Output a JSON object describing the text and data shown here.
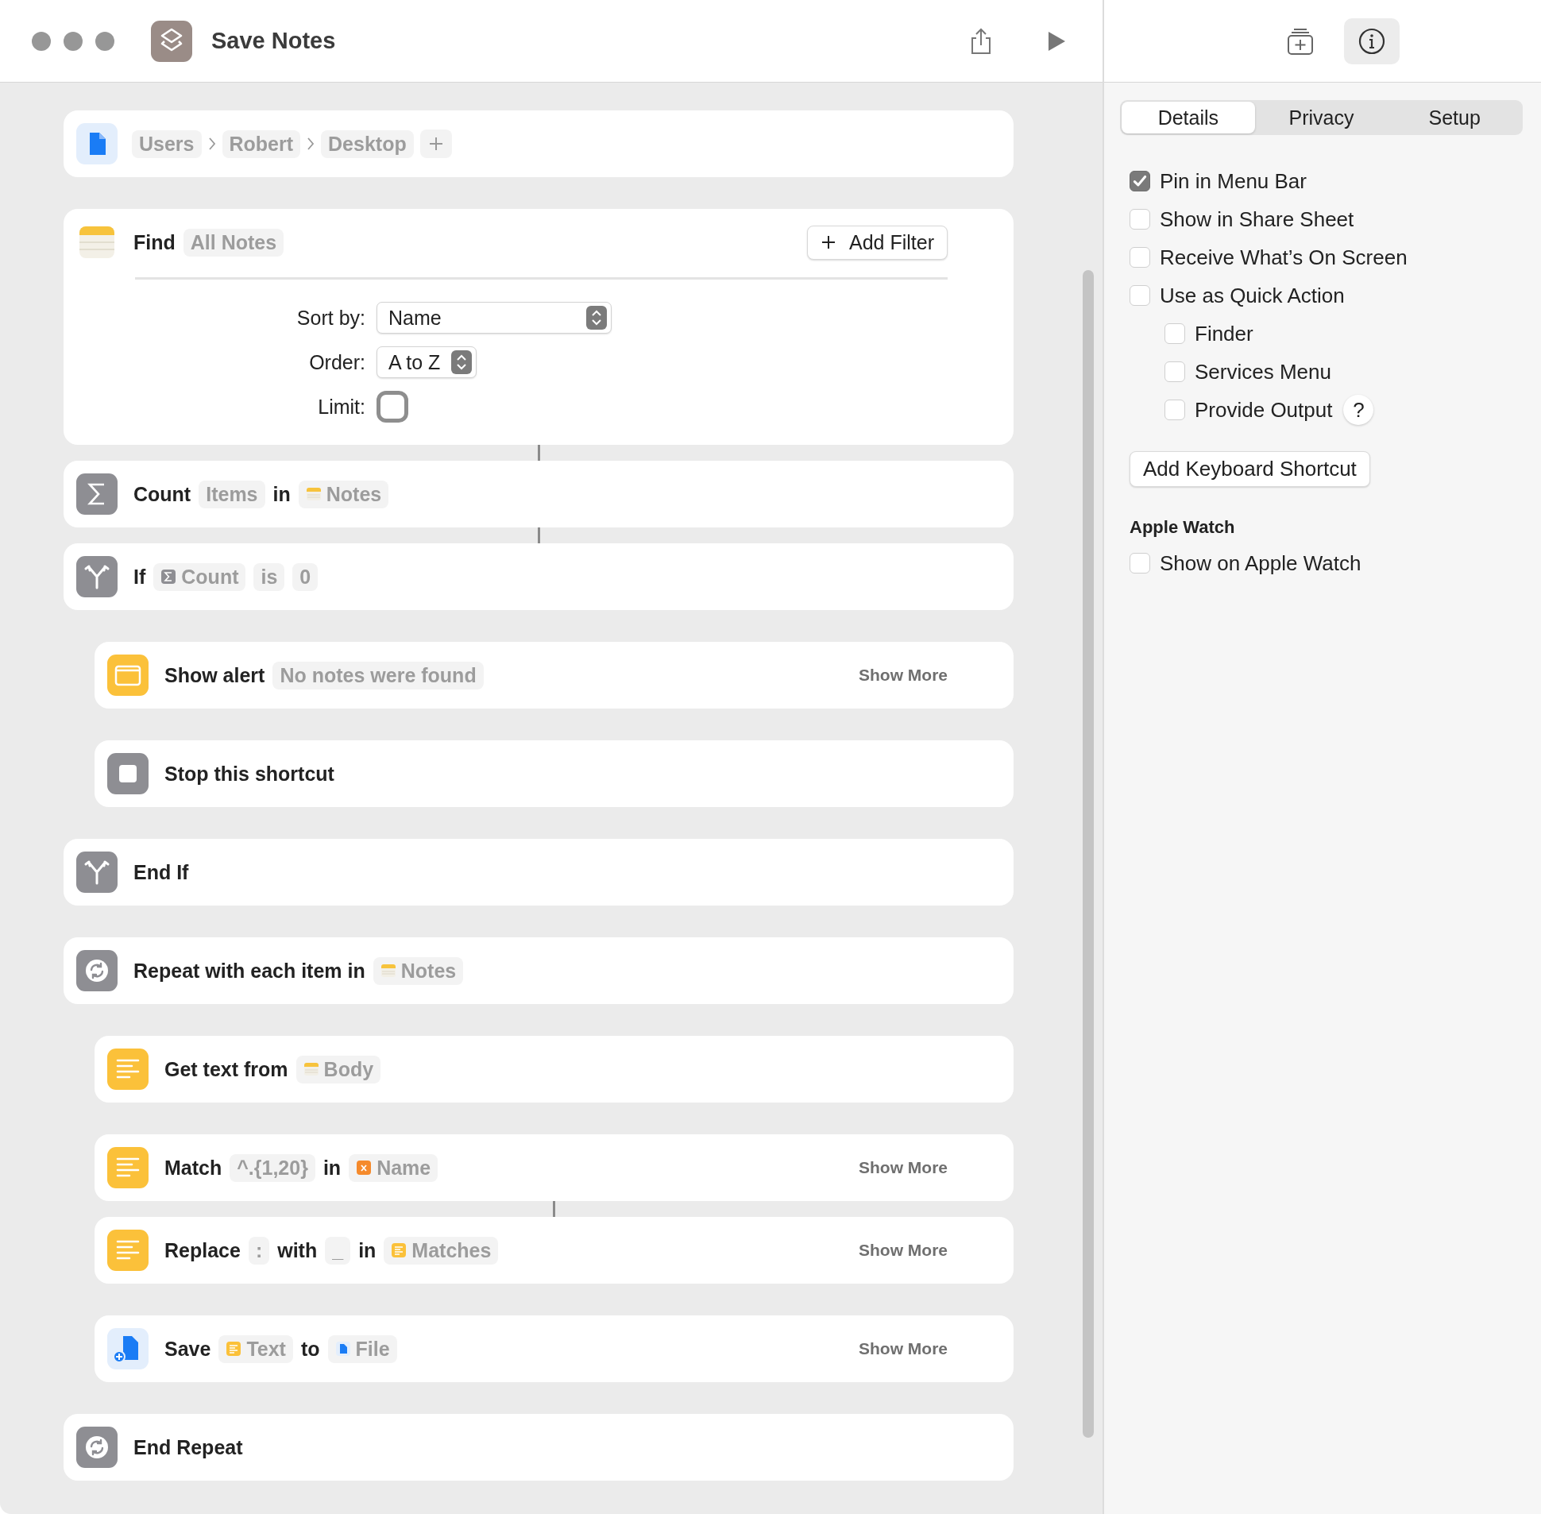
{
  "window": {
    "title": "Save Notes"
  },
  "toolbar_buttons": [
    {
      "kind": "library",
      "selected": false
    },
    {
      "kind": "info",
      "selected": true
    }
  ],
  "actions": [
    {
      "kind": "file-path",
      "parts": [
        {
          "kind": "crumb",
          "text": "Users"
        },
        {
          "kind": "crumb",
          "text": "Robert"
        },
        {
          "kind": "crumb",
          "text": "Desktop"
        }
      ],
      "connected": false
    },
    {
      "kind": "find",
      "parts": [
        {
          "kind": "label",
          "text": "Find"
        },
        {
          "kind": "token",
          "text": "All Notes"
        }
      ],
      "add_filter": "Add Filter",
      "options": [
        {
          "kind": "popup",
          "label": "Sort by:",
          "value": "Name",
          "wide": true
        },
        {
          "kind": "popup",
          "label": "Order:",
          "value": "A to Z",
          "wide": false
        },
        {
          "kind": "toggle",
          "label": "Limit:",
          "on": false
        }
      ],
      "connected": true
    },
    {
      "kind": "count",
      "parts": [
        {
          "kind": "label",
          "text": "Count"
        },
        {
          "kind": "token",
          "text": "Items"
        },
        {
          "kind": "label",
          "text": "in"
        },
        {
          "kind": "notes-token",
          "text": "Notes"
        }
      ],
      "connected": true
    },
    {
      "kind": "if",
      "parts": [
        {
          "kind": "label",
          "text": "If"
        },
        {
          "kind": "count-token",
          "text": "Count"
        },
        {
          "kind": "token",
          "text": "is"
        },
        {
          "kind": "token",
          "text": "0"
        }
      ],
      "connected": false,
      "children": [
        {
          "kind": "alert",
          "parts": [
            {
              "kind": "label",
              "text": "Show alert"
            },
            {
              "kind": "token",
              "text": "No notes were found"
            }
          ],
          "show_more": "Show More",
          "connected": false
        },
        {
          "kind": "stop",
          "parts": [
            {
              "kind": "label",
              "text": "Stop this shortcut"
            }
          ],
          "connected": false
        }
      ]
    },
    {
      "kind": "end-if",
      "parts": [
        {
          "kind": "label",
          "text": "End If"
        }
      ],
      "connected": false
    },
    {
      "kind": "repeat",
      "parts": [
        {
          "kind": "label",
          "text": "Repeat with each item in"
        },
        {
          "kind": "notes-token",
          "text": "Notes"
        }
      ],
      "connected": false,
      "children": [
        {
          "kind": "text",
          "parts": [
            {
              "kind": "label",
              "text": "Get text from"
            },
            {
              "kind": "notes-token",
              "text": "Body"
            }
          ],
          "connected": false
        },
        {
          "kind": "text",
          "parts": [
            {
              "kind": "label",
              "text": "Match"
            },
            {
              "kind": "token",
              "text": "^.{1,20}"
            },
            {
              "kind": "label",
              "text": "in"
            },
            {
              "kind": "variable-token",
              "text": "Name"
            }
          ],
          "show_more": "Show More",
          "connected": true
        },
        {
          "kind": "text",
          "parts": [
            {
              "kind": "label",
              "text": "Replace"
            },
            {
              "kind": "token",
              "text": ":"
            },
            {
              "kind": "label",
              "text": "with"
            },
            {
              "kind": "token",
              "text": "_"
            },
            {
              "kind": "label",
              "text": "in"
            },
            {
              "kind": "text-token",
              "text": "Matches"
            }
          ],
          "show_more": "Show More",
          "connected": false
        },
        {
          "kind": "save",
          "parts": [
            {
              "kind": "label",
              "text": "Save"
            },
            {
              "kind": "text-token",
              "text": "Text"
            },
            {
              "kind": "label",
              "text": "to"
            },
            {
              "kind": "file-token",
              "text": "File"
            }
          ],
          "show_more": "Show More",
          "connected": false
        }
      ]
    },
    {
      "kind": "end-repeat",
      "parts": [
        {
          "kind": "label",
          "text": "End Repeat"
        }
      ],
      "connected": false
    }
  ],
  "tabs": [
    {
      "label": "Details",
      "selected": true
    },
    {
      "label": "Privacy",
      "selected": false
    },
    {
      "label": "Setup",
      "selected": false
    }
  ],
  "settings": [
    {
      "label": "Pin in Menu Bar",
      "checked": true
    },
    {
      "label": "Show in Share Sheet",
      "checked": false
    },
    {
      "label": "Receive What’s On Screen",
      "checked": false
    },
    {
      "label": "Use as Quick Action",
      "checked": false,
      "children": [
        {
          "label": "Finder",
          "checked": false
        },
        {
          "label": "Services Menu",
          "checked": false
        },
        {
          "label": "Provide Output",
          "checked": false,
          "help": "?"
        }
      ]
    }
  ],
  "shortcut_button": "Add Keyboard Shortcut",
  "apple_watch": {
    "heading": "Apple Watch",
    "options": [
      {
        "label": "Show on Apple Watch",
        "checked": false
      }
    ]
  }
}
